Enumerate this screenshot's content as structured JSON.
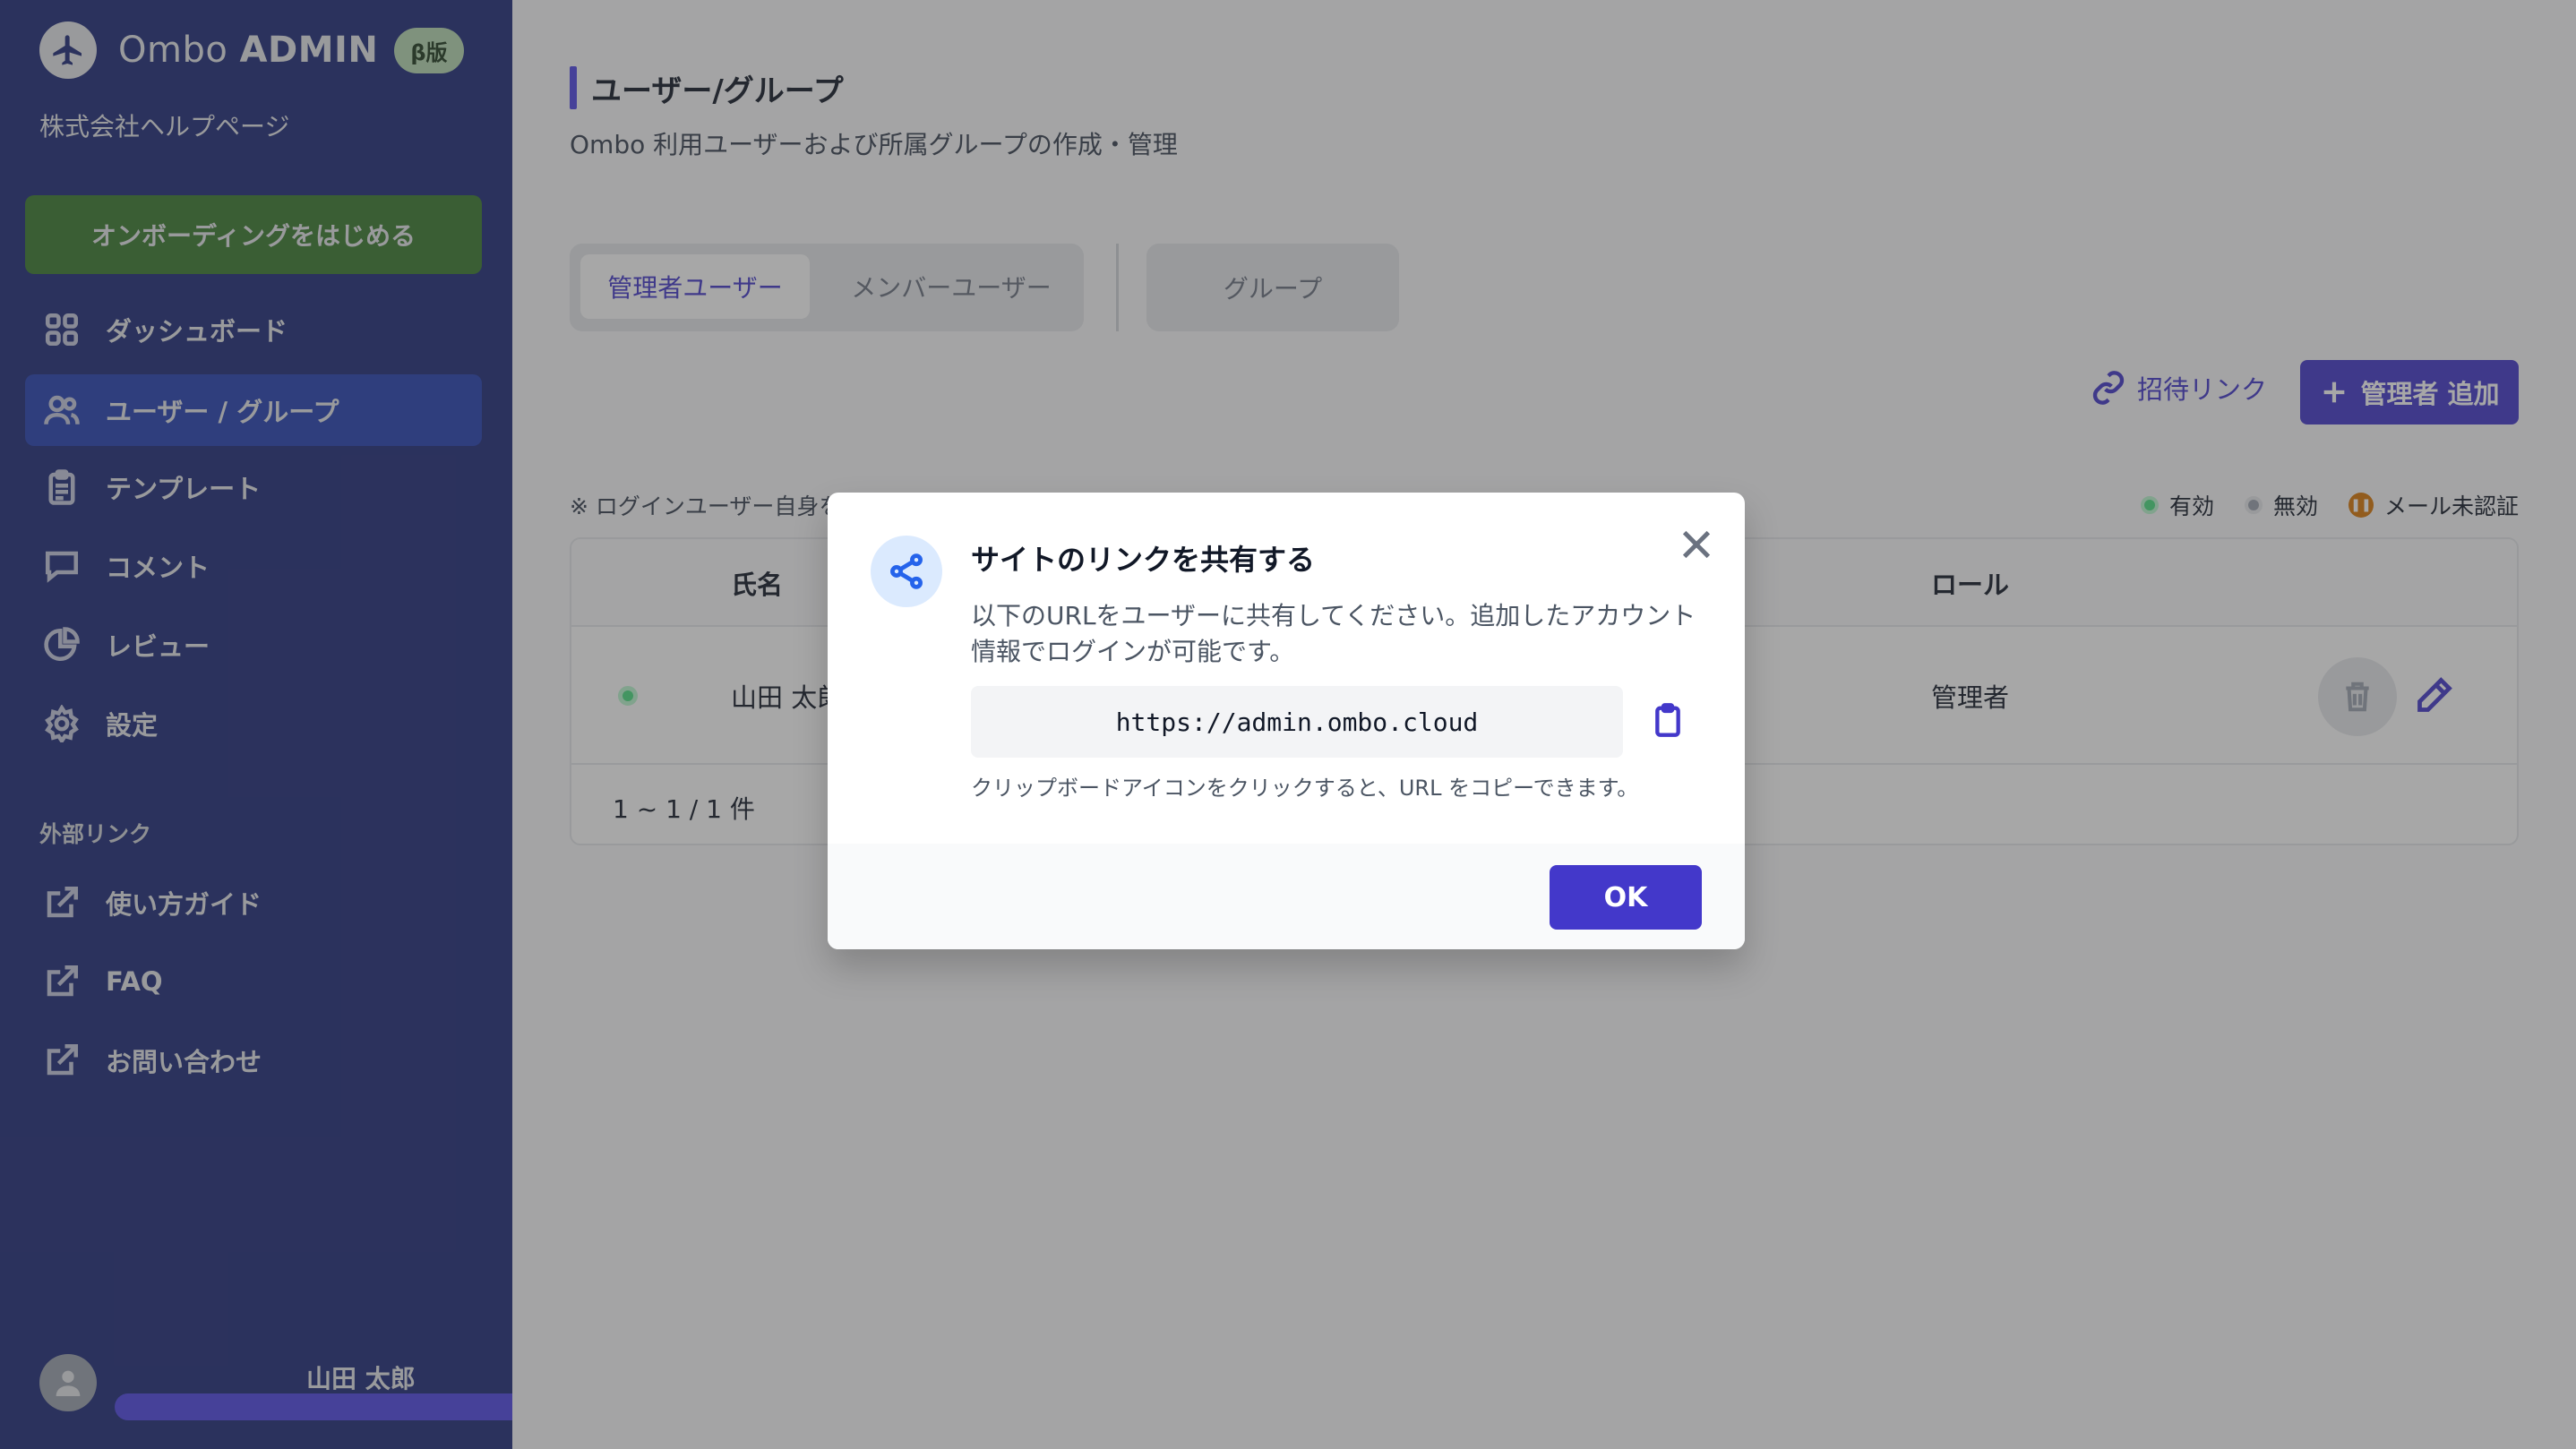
{
  "sidebar": {
    "brand_light": "Ombo",
    "brand_bold": "ADMIN",
    "beta_badge": "β版",
    "company": "株式会社ヘルプページ",
    "onboarding_button": "オンボーディングをはじめる",
    "nav": [
      {
        "label": "ダッシュボード",
        "icon": "dashboard-icon"
      },
      {
        "label": "ユーザー / グループ",
        "icon": "users-icon"
      },
      {
        "label": "テンプレート",
        "icon": "clipboard-icon"
      },
      {
        "label": "コメント",
        "icon": "comment-icon"
      },
      {
        "label": "レビュー",
        "icon": "pie-chart-icon"
      },
      {
        "label": "設定",
        "icon": "gear-icon"
      }
    ],
    "external_label": "外部リンク",
    "external": [
      {
        "label": "使い方ガイド",
        "icon": "external-link-icon"
      },
      {
        "label": "FAQ",
        "icon": "external-link-icon"
      },
      {
        "label": "お問い合わせ",
        "icon": "external-link-icon"
      }
    ],
    "user_name": "山田 太郎"
  },
  "main": {
    "title": "ユーザー/グループ",
    "subtitle": "Ombo 利用ユーザーおよび所属グループの作成・管理",
    "tabs": {
      "admin": "管理者ユーザー",
      "member": "メンバーユーザー",
      "group": "グループ"
    },
    "invite_link": "招待リンク",
    "add_button": "管理者 追加",
    "note": "※ ログインユーザー自身を",
    "legend": {
      "active": "有効",
      "inactive": "無効",
      "unverified": "メール未認証"
    },
    "table": {
      "headers": {
        "name": "氏名",
        "role": "ロール"
      },
      "rows": [
        {
          "name": "山田 太郎",
          "role": "管理者"
        }
      ],
      "pager": "1 ~ 1 / 1 件"
    }
  },
  "modal": {
    "title": "サイトのリンクを共有する",
    "description": "以下のURLをユーザーに共有してください。追加したアカウント情報でログインが可能です。",
    "url": "https://admin.ombo.cloud",
    "hint": "クリップボードアイコンをクリックすると、URL をコピーできます。",
    "ok_button": "OK"
  },
  "colors": {
    "sidebar_bg": "#1e2a78",
    "sidebar_active": "#2541b2",
    "accent": "#4338ca",
    "onboarding": "#3a7a2e"
  }
}
